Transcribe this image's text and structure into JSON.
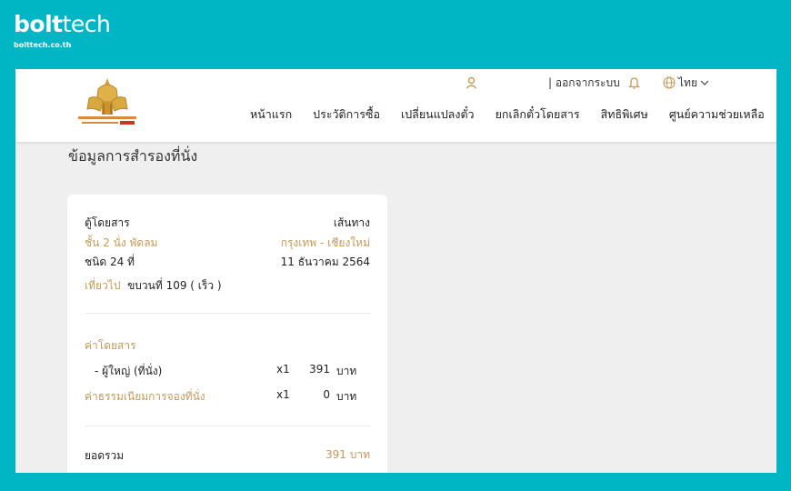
{
  "brand": {
    "logo_bold": "bolt",
    "logo_light": "tech",
    "url": "bolttech.co.th"
  },
  "header": {
    "logout": "| ออกจากระบบ",
    "language": "ไทย",
    "nav": [
      "หน้าแรก",
      "ประวัติการซื้อ",
      "เปลี่ยนแปลงตั๋ว",
      "ยกเลิกตั๋วโดยสาร",
      "สิทธิพิเศษ",
      "ศูนย์ความช่วยเหลือ"
    ]
  },
  "page": {
    "title": "ข้อมูลการสำรองที่นั่ง"
  },
  "booking": {
    "car_label": "ตู้โดยสาร",
    "car_value": "ชั้น 2 นั่ง พัดลม",
    "seat": "ชนิด 24 ที่",
    "route_label": "เส้นทาง",
    "route_value": "กรุงเทพ - เชียงใหม่",
    "date": "11 ธันวาคม 2564",
    "trip_label": "เที่ยวไป",
    "train": "ขบวนที่ 109 ( เร็ว )"
  },
  "fare": {
    "title": "ค่าโดยสาร",
    "items": [
      {
        "label": "- ผู้ใหญ่ (ที่นั่ง)",
        "qty": "x1",
        "amount": "391",
        "unit": "บาท"
      },
      {
        "label": "ค่าธรรมเนียมการจองที่นั่ง",
        "qty": "x1",
        "amount": "0",
        "unit": "บาท"
      }
    ],
    "total_label": "ยอดรวม",
    "total_value": "391 บาท"
  },
  "colors": {
    "background": "#00b5c4",
    "accent_gold": "#c29a5b",
    "panel": "#efefef"
  },
  "icons": [
    "user-icon",
    "bell-icon",
    "globe-icon",
    "chevron-down-icon",
    "srt-logo"
  ]
}
